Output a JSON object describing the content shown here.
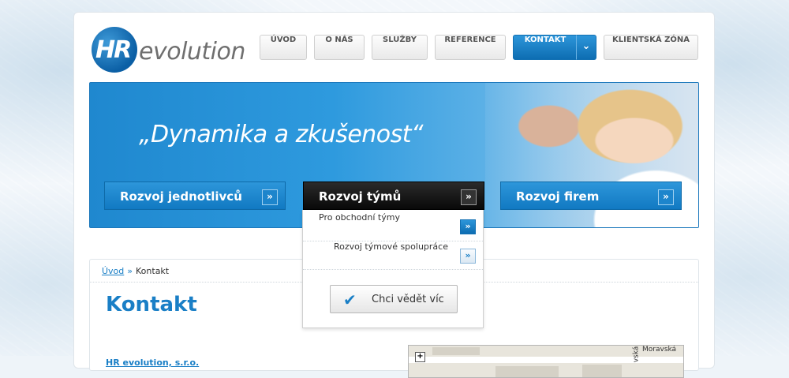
{
  "logo": {
    "mark": "HR",
    "wordmark": "evolution"
  },
  "nav": {
    "items": [
      {
        "label": "ÚVOD"
      },
      {
        "label": "O NÁS"
      },
      {
        "label": "SLUŽBY"
      },
      {
        "label": "REFERENCE"
      },
      {
        "label": "KONTAKT",
        "active": true
      },
      {
        "label": "KLIENTSKÁ ZÓNA"
      }
    ],
    "dropdown_icon": "double-chevron-down-icon"
  },
  "hero": {
    "slogan": "„Dynamika a zkušenost“",
    "buttons": [
      {
        "label": "Rozvoj jednotlivců"
      },
      {
        "label": "Rozvoj týmů",
        "active": true
      },
      {
        "label": "Rozvoj firem"
      }
    ],
    "arrow_glyph": "»"
  },
  "dropdown": {
    "items": [
      {
        "label": "Pro obchodní týmy"
      },
      {
        "label": "Rozvoj týmové spolupráce"
      }
    ],
    "cta_label": "Chci vědět víc",
    "cta_icon": "checkmark-icon"
  },
  "breadcrumb": {
    "home": "Úvod",
    "separator": "»",
    "current": "Kontakt"
  },
  "main": {
    "title": "Kontakt",
    "company": "HR evolution, s.r.o."
  },
  "map": {
    "street_1": "Moravská",
    "street_2": "vská",
    "zoom_glyph": "+"
  },
  "colors": {
    "accent": "#1a7fc6",
    "dark_button": "#111111"
  }
}
